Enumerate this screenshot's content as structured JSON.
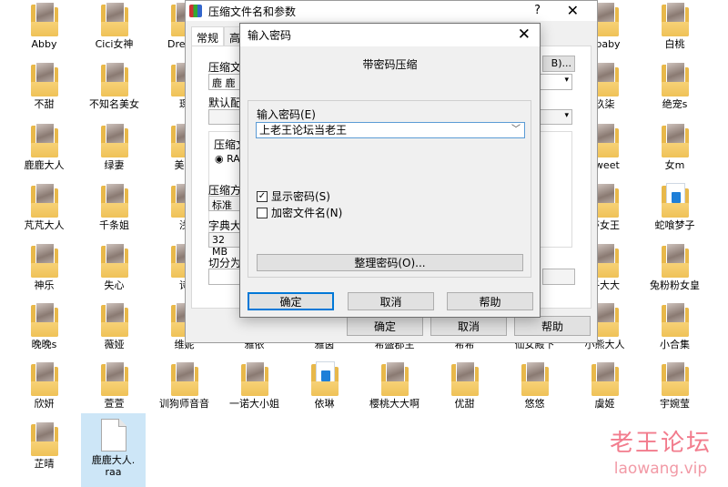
{
  "desktop": {
    "items": [
      {
        "label": "Abby",
        "icon": "photo-folder-icon"
      },
      {
        "label": "Cici女神",
        "icon": "photo-folder-icon"
      },
      {
        "label": "Dream",
        "icon": "photo-folder-icon"
      },
      {
        "label": "Ebaby",
        "icon": "photo-folder-icon"
      },
      {
        "label": "白桃",
        "icon": "photo-folder-icon"
      },
      {
        "label": "不甜",
        "icon": "photo-folder-icon"
      },
      {
        "label": "不知名美女",
        "icon": "photo-folder-icon"
      },
      {
        "label": "琛",
        "icon": "photo-folder-icon"
      },
      {
        "label": "玖柒",
        "icon": "photo-folder-icon"
      },
      {
        "label": "绝宠s",
        "icon": "photo-folder-icon"
      },
      {
        "label": "鹿鹿大人",
        "icon": "photo-folder-icon"
      },
      {
        "label": "绿妻",
        "icon": "photo-folder-icon"
      },
      {
        "label": "美腐",
        "icon": "photo-folder-icon"
      },
      {
        "label": "sweet",
        "icon": "photo-folder-icon"
      },
      {
        "label": "女m",
        "icon": "photo-folder-icon"
      },
      {
        "label": "芃芃大人",
        "icon": "photo-folder-icon"
      },
      {
        "label": "千条姐",
        "icon": "photo-folder-icon"
      },
      {
        "label": "浅",
        "icon": "photo-folder-icon"
      },
      {
        "label": "莎女王",
        "icon": "photo-folder-icon"
      },
      {
        "label": "蛇喰梦子",
        "icon": "video-folder-icon"
      },
      {
        "label": "神乐",
        "icon": "photo-folder-icon"
      },
      {
        "label": "失心",
        "icon": "photo-folder-icon"
      },
      {
        "label": "诗",
        "icon": "photo-folder-icon"
      },
      {
        "label": "子大大",
        "icon": "photo-folder-icon"
      },
      {
        "label": "兔粉粉女皇",
        "icon": "photo-folder-icon"
      },
      {
        "label": "晚晚s",
        "icon": "photo-folder-icon"
      },
      {
        "label": "薇娅",
        "icon": "photo-folder-icon"
      },
      {
        "label": "维妮",
        "icon": "photo-folder-icon"
      },
      {
        "label": "雅依",
        "icon": "photo-folder-icon"
      },
      {
        "label": "雅茵",
        "icon": "photo-folder-icon"
      },
      {
        "label": "希盛郡主",
        "icon": "photo-folder-icon"
      },
      {
        "label": "希希",
        "icon": "photo-folder-icon"
      },
      {
        "label": "仙女殿下",
        "icon": "photo-folder-icon"
      },
      {
        "label": "小熊大人",
        "icon": "photo-folder-icon"
      },
      {
        "label": "小合集",
        "icon": "photo-folder-icon"
      },
      {
        "label": "欣妍",
        "icon": "photo-folder-icon"
      },
      {
        "label": "萱萱",
        "icon": "photo-folder-icon"
      },
      {
        "label": "训狗师音音",
        "icon": "photo-folder-icon"
      },
      {
        "label": "一诺大小姐",
        "icon": "photo-folder-icon"
      },
      {
        "label": "依琳",
        "icon": "video-folder-icon"
      },
      {
        "label": "樱桃大大啊",
        "icon": "photo-folder-icon"
      },
      {
        "label": "优甜",
        "icon": "photo-folder-icon"
      },
      {
        "label": "悠悠",
        "icon": "photo-folder-icon"
      },
      {
        "label": "虞姬",
        "icon": "photo-folder-icon"
      },
      {
        "label": "宇婉莹",
        "icon": "photo-folder-icon"
      },
      {
        "label": "芷晴",
        "icon": "photo-folder-icon"
      }
    ],
    "selected_file": {
      "label_line1": "鹿鹿大人.",
      "label_line2": "raa",
      "icon": "archive-file-icon"
    }
  },
  "outer_dialog": {
    "title": "压缩文件名和参数",
    "help_label": "?",
    "close_label": "✕",
    "tabs": [
      {
        "label": "常规"
      },
      {
        "label": "高"
      }
    ],
    "archive_name_label": "压缩文",
    "archive_name_value": "鹿 鹿",
    "browse_label": "B)...",
    "default_config_label": "默认配",
    "format_group_label": "压缩文",
    "format_option": "RA",
    "method_label": "压缩方",
    "method_value": "标准",
    "dict_label": "字典大",
    "dict_value": "32 MB",
    "split_label": "切分为",
    "ok_label": "确定",
    "cancel_label": "取消",
    "help_btn_label": "帮助"
  },
  "password_dialog": {
    "title": "输入密码",
    "close_label": "✕",
    "heading": "带密码压缩",
    "password_label": "输入密码(E)",
    "password_value": "上老王论坛当老王",
    "show_password_label": "显示密码(S)",
    "show_password_checked": true,
    "encrypt_names_label": "加密文件名(N)",
    "encrypt_names_checked": false,
    "manage_label": "整理密码(O)...",
    "ok_label": "确定",
    "cancel_label": "取消",
    "help_label": "帮助",
    "accent_color": "#0078d7"
  },
  "watermark": {
    "title": "老王论坛",
    "url": "laowang.vip"
  }
}
